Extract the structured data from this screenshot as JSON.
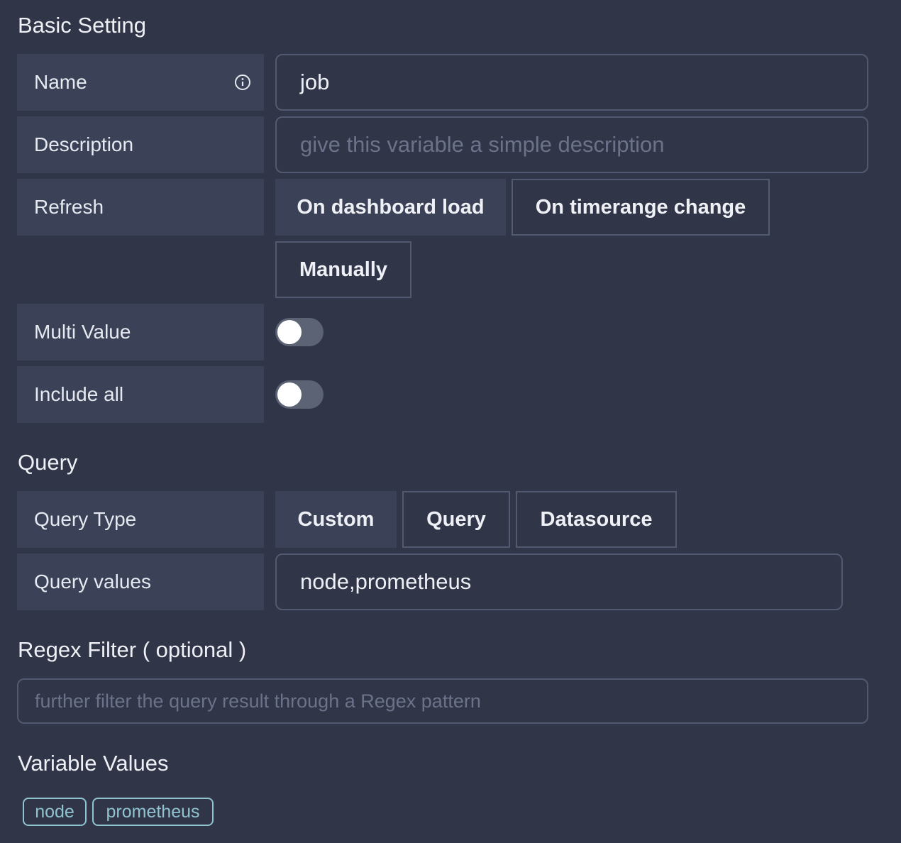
{
  "basic_setting": {
    "title": "Basic Setting",
    "name_label": "Name",
    "name_value": "job",
    "description_label": "Description",
    "description_placeholder": "give this variable a simple description",
    "refresh_label": "Refresh",
    "refresh_options": [
      "On dashboard load",
      "On timerange change",
      "Manually"
    ],
    "refresh_selected": "On dashboard load",
    "multi_value_label": "Multi Value",
    "multi_value_enabled": false,
    "include_all_label": "Include all",
    "include_all_enabled": false
  },
  "query": {
    "title": "Query",
    "type_label": "Query Type",
    "type_options": [
      "Custom",
      "Query",
      "Datasource"
    ],
    "type_selected": "Custom",
    "values_label": "Query values",
    "values_value": "node,prometheus"
  },
  "regex": {
    "title": "Regex Filter ( optional )",
    "placeholder": "further filter the query result through a Regex pattern"
  },
  "variable_values": {
    "title": "Variable Values",
    "tags": [
      "node",
      "prometheus"
    ]
  },
  "colors": {
    "background": "#303548",
    "label_bg": "#3b4156",
    "border": "#525a72",
    "tag_accent": "#8fc3cf"
  },
  "icons": {
    "name_info": "info-icon"
  }
}
